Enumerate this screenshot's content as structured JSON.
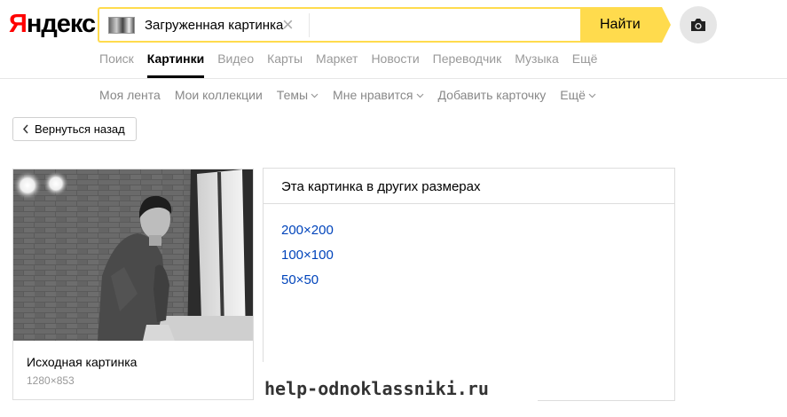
{
  "logo": {
    "first_letter": "Я",
    "rest": "ндекс"
  },
  "search": {
    "chip_label": "Загруженная картинка",
    "close_glyph": "×",
    "button_label": "Найти"
  },
  "tabs": [
    {
      "label": "Поиск",
      "active": false
    },
    {
      "label": "Картинки",
      "active": true
    },
    {
      "label": "Видео",
      "active": false
    },
    {
      "label": "Карты",
      "active": false
    },
    {
      "label": "Маркет",
      "active": false
    },
    {
      "label": "Новости",
      "active": false
    },
    {
      "label": "Переводчик",
      "active": false
    },
    {
      "label": "Музыка",
      "active": false
    },
    {
      "label": "Ещё",
      "active": false
    }
  ],
  "subnav": [
    {
      "label": "Моя лента",
      "dropdown": false
    },
    {
      "label": "Мои коллекции",
      "dropdown": false
    },
    {
      "label": "Темы",
      "dropdown": true
    },
    {
      "label": "Мне нравится",
      "dropdown": true
    },
    {
      "label": "Добавить карточку",
      "dropdown": false
    },
    {
      "label": "Ещё",
      "dropdown": true
    }
  ],
  "back_button": {
    "label": "Вернуться назад"
  },
  "original_card": {
    "title": "Исходная картинка",
    "size": "1280×853"
  },
  "sizes_panel": {
    "title": "Эта картинка в других размерах",
    "links": [
      "200×200",
      "100×100",
      "50×50"
    ]
  },
  "watermark": {
    "text": "help-odnoklassniki.ru"
  },
  "colors": {
    "accent": "#ffdb4d",
    "logo_red": "#ff0000",
    "link": "#0044bb"
  },
  "icons": {
    "camera": "camera-icon",
    "back": "chevron-left-icon",
    "close": "close-icon",
    "caret": "chevron-down-icon"
  }
}
